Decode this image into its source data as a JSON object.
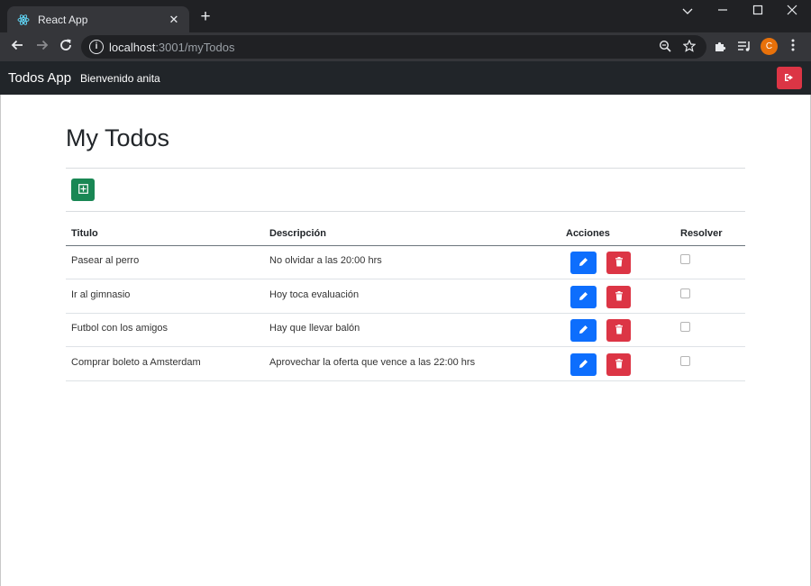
{
  "browser": {
    "tab_title": "React App",
    "tab_close": "✕",
    "new_tab": "+",
    "url_host": "localhost",
    "url_rest": ":3001/myTodos",
    "profile_initial": "C",
    "icons": {
      "favicon": "react-icon",
      "back": "arrow-left-icon",
      "forward": "arrow-right-icon",
      "reload": "reload-icon",
      "site_info": "info-icon",
      "zoom": "zoom-out-icon",
      "bookmark": "star-icon",
      "extensions": "puzzle-icon",
      "media": "media-control-icon",
      "menu": "kebab-menu-icon",
      "tab_search": "chevron-down-icon",
      "minimize": "minimize-icon",
      "maximize": "maximize-icon",
      "close": "close-icon"
    }
  },
  "navbar": {
    "brand": "Todos App",
    "welcome": "Bienvenido anita",
    "logout_icon": "sign-out-icon"
  },
  "main": {
    "title": "My Todos",
    "add_icon": "plus-square-icon"
  },
  "table": {
    "headers": {
      "title": "Titulo",
      "description": "Descripción",
      "actions": "Acciones",
      "resolve": "Resolver"
    },
    "rows": [
      {
        "title": "Pasear al perro",
        "description": "No olvidar a las 20:00 hrs",
        "resolved": false
      },
      {
        "title": "Ir al gimnasio",
        "description": "Hoy toca evaluación",
        "resolved": false
      },
      {
        "title": "Futbol con los amigos",
        "description": "Hay que llevar balón",
        "resolved": false
      },
      {
        "title": "Comprar boleto a Amsterdam",
        "description": "Aprovechar la oferta que vence a las 22:00 hrs",
        "resolved": false
      }
    ],
    "edit_icon": "pencil-icon",
    "delete_icon": "trash-icon"
  },
  "colors": {
    "navbar_bg": "#212529",
    "add_button": "#198754",
    "edit_button": "#0d6efd",
    "delete_button": "#dc3545",
    "logout_button": "#dc3545"
  }
}
